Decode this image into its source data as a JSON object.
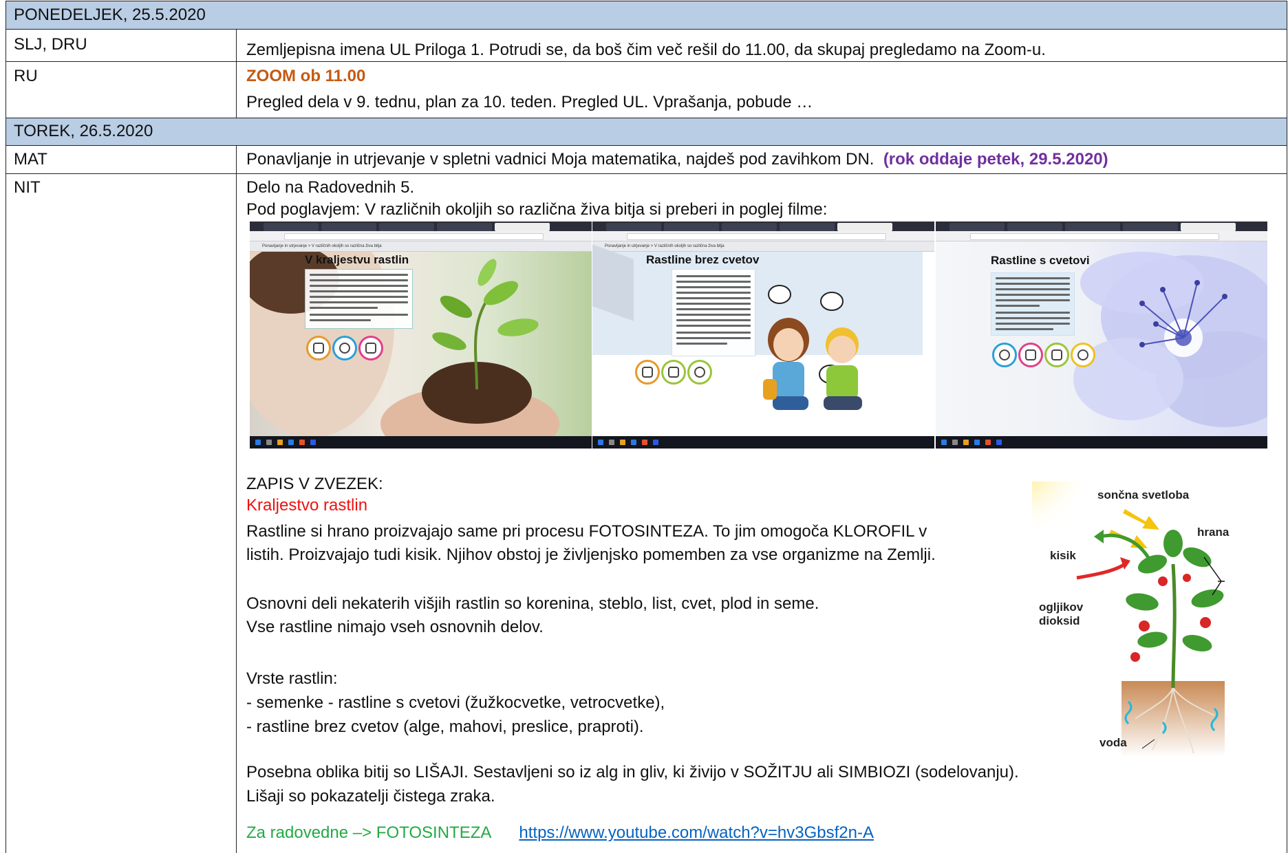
{
  "days": [
    {
      "header": "PONEDELJEK, 25.5.2020",
      "rows": [
        {
          "subject": "SLJ, DRU",
          "text": "Zemljepisna imena UL Priloga 1. Potrudi se, da boš čim več rešil do 11.00, da skupaj pregledamo na Zoom-u."
        },
        {
          "subject": "RU",
          "highlight": "ZOOM ob 11.00",
          "text": "Pregled dela v 9. tednu, plan za 10. teden. Pregled UL. Vprašanja, pobude …"
        }
      ]
    },
    {
      "header": "TOREK, 26.5.2020",
      "rows": [
        {
          "subject": "MAT",
          "text": "Ponavljanje in utrjevanje v spletni vadnici Moja matematika, najdeš pod zavihkom DN.",
          "deadline": "(rok oddaje petek, 29.5.2020)"
        },
        {
          "subject": "NIT",
          "line1": "Delo na Radovednih 5.",
          "line2": "Pod poglavjem: V različnih okoljih so različna živa bitja si preberi in poglej filme:",
          "screenshots": [
            {
              "title": "V kraljestvu rastlin",
              "crumb": "Ponavljanje in utrjevanje > V različnih okoljih so različna živa bitja"
            },
            {
              "title": "Rastline brez cvetov",
              "crumb": "Ponavljanje in utrjevanje > V različnih okoljih so različna živa bitja"
            },
            {
              "title": "Rastline s cvetovi",
              "crumb": ""
            }
          ],
          "notes_heading": "ZAPIS V ZVEZEK:",
          "notes_title": "Kraljestvo rastlin",
          "p1a": "Rastline si hrano proizvajajo same pri procesu FOTOSINTEZA. To jim omogoča KLOROFIL v",
          "p1b": "listih. Proizvajajo tudi kisik. Njihov obstoj je življenjsko pomemben za vse organizme na Zemlji.",
          "p2a": "Osnovni deli nekaterih višjih rastlin so korenina, steblo, list, cvet, plod in seme.",
          "p2b": "Vse rastline nimajo vseh osnovnih delov.",
          "p3a": "Vrste rastlin:",
          "p3b": "- semenke - rastline s cvetovi (žužkocvetke, vetrocvetke),",
          "p3c": "- rastline brez cvetov (alge, mahovi, preslice, praproti).",
          "p4a": "Posebna oblika bitij so LIŠAJI. Sestavljeni so iz alg in gliv, ki živijo v SOŽITJU ali SIMBIOZI (sodelovanju).",
          "p4b": "Lišaji so pokazatelji čistega zraka.",
          "extra_label": "Za radovedne –> FOTOSINTEZA",
          "extra_link": "https://www.youtube.com/watch?v=hv3Gbsf2n-A",
          "diagram": {
            "sunlight": "sončna svetloba",
            "food": "hrana",
            "oxygen": "kisik",
            "co2_a": "ogljikov",
            "co2_b": "dioksid",
            "water": "voda"
          }
        }
      ]
    }
  ],
  "colors": {
    "header_band": "#b9cde4",
    "deadline": "#7030a0",
    "zoom": "#c55a11",
    "notes_title": "#ee1111",
    "extra": "#22aa44",
    "link": "#0563c1"
  }
}
